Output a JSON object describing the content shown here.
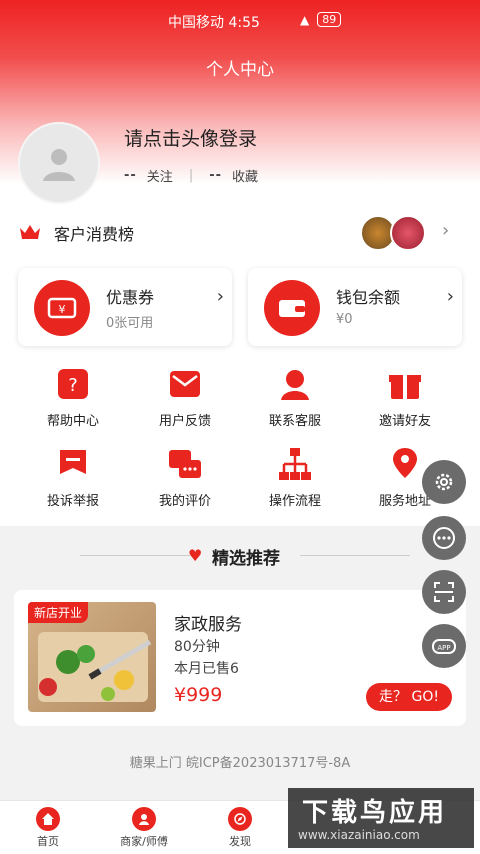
{
  "status_bar": {
    "carrier_time": "中国移动 4:55",
    "battery": "89"
  },
  "header": {
    "title": "个人中心"
  },
  "profile": {
    "login_prompt": "请点击头像登录",
    "follow_count": "--",
    "follow_label": "关注",
    "fav_count": "--",
    "fav_label": "收藏"
  },
  "ranking": {
    "label": "客户消费榜"
  },
  "cards": [
    {
      "title": "优惠券",
      "subtitle": "0张可用"
    },
    {
      "title": "钱包余额",
      "subtitle": "¥0"
    }
  ],
  "grid": [
    {
      "label": "帮助中心",
      "icon": "help-icon"
    },
    {
      "label": "用户反馈",
      "icon": "feedback-icon"
    },
    {
      "label": "联系客服",
      "icon": "customer-service-icon"
    },
    {
      "label": "邀请好友",
      "icon": "gift-icon"
    },
    {
      "label": "投诉举报",
      "icon": "complaint-icon"
    },
    {
      "label": "我的评价",
      "icon": "review-icon"
    },
    {
      "label": "操作流程",
      "icon": "flowchart-icon"
    },
    {
      "label": "服务地址",
      "icon": "location-icon"
    }
  ],
  "section": {
    "title": "精选推荐"
  },
  "product": {
    "badge": "新店开业",
    "name": "家政服务",
    "duration": "80分钟",
    "sold": "本月已售6",
    "price": "¥999",
    "go_label": "走？ GO!"
  },
  "footer": {
    "icp": "糖果上门 皖ICP备2023013717号-8A"
  },
  "tabs": [
    {
      "label": "首页"
    },
    {
      "label": "商家/师傅"
    },
    {
      "label": "发现"
    }
  ],
  "watermark": {
    "title": "下载鸟应用",
    "url": "www.xiazainiao.com"
  },
  "colors": {
    "accent": "#e8261f"
  }
}
